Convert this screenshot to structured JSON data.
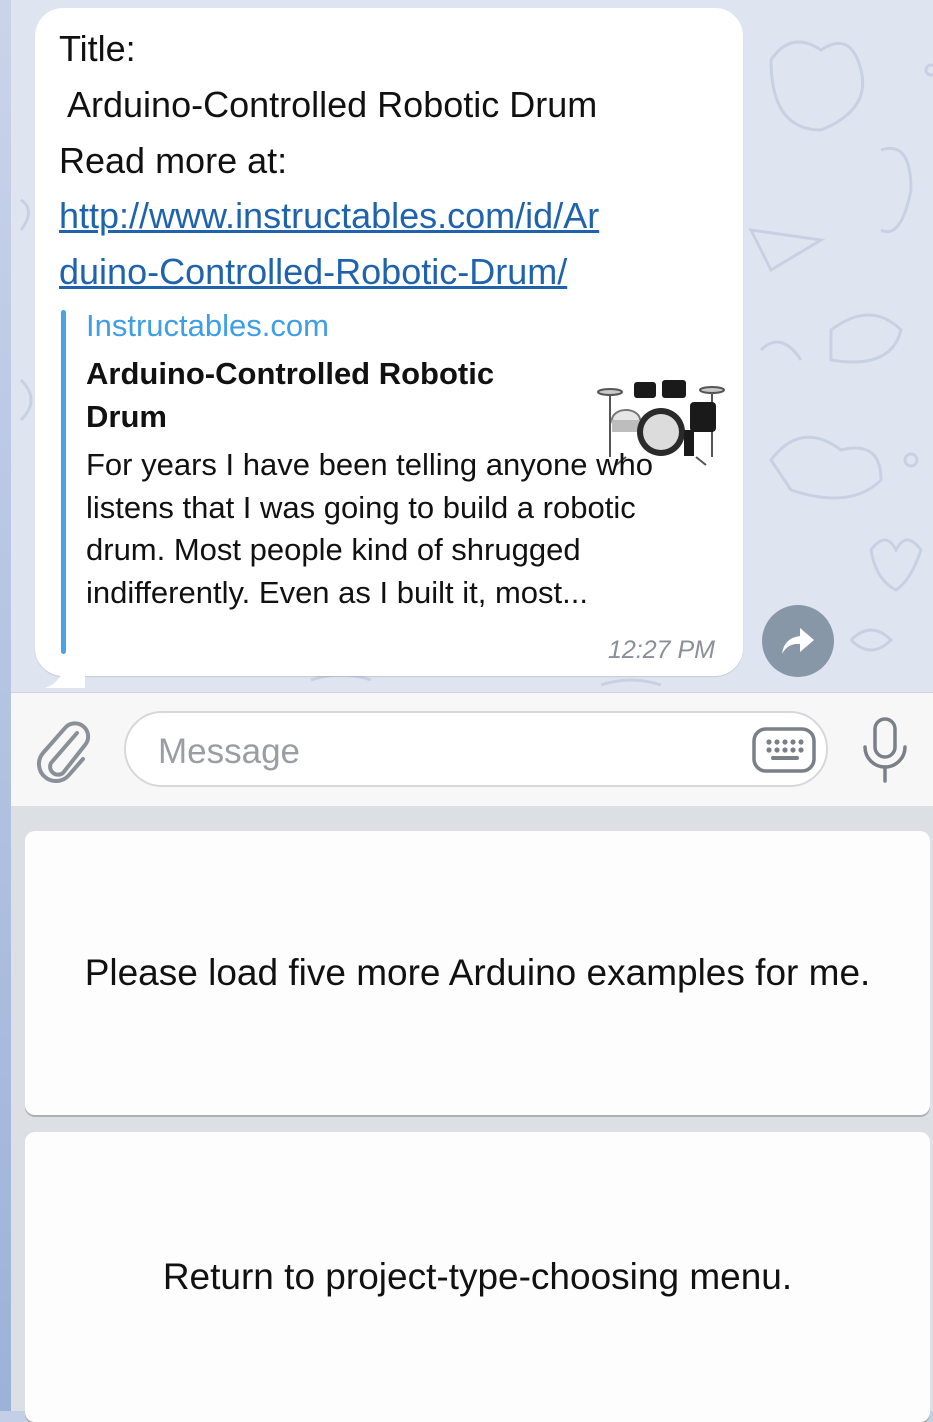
{
  "message": {
    "title_label": "Title:",
    "title_value": " Arduino-Controlled Robotic Drum",
    "read_more_label": "Read more at:",
    "link_line1": "http://www.instructables.com/id/Ar",
    "link_line2": "duino-Controlled-Robotic-Drum/",
    "time": "12:27 PM"
  },
  "link_preview": {
    "site": "Instructables.com",
    "title": "Arduino-Controlled Robotic Drum",
    "description": "For years I have been telling anyone who listens that I was going to build a robotic drum. Most people kind of shrugged indifferently. Even as I built it, most..."
  },
  "composer": {
    "placeholder": "Message",
    "icons": {
      "attach": "paperclip-icon",
      "keyboard": "keyboard-icon",
      "mic": "microphone-icon",
      "share": "share-arrow-icon"
    }
  },
  "reply_keyboard": {
    "buttons": [
      "Please load five more Arduino examples for me.",
      "Return to project-type-choosing menu."
    ]
  },
  "colors": {
    "link": "#1f63ae",
    "preview_accent": "#3e9ee6",
    "chat_background": "#dfe5f0"
  }
}
